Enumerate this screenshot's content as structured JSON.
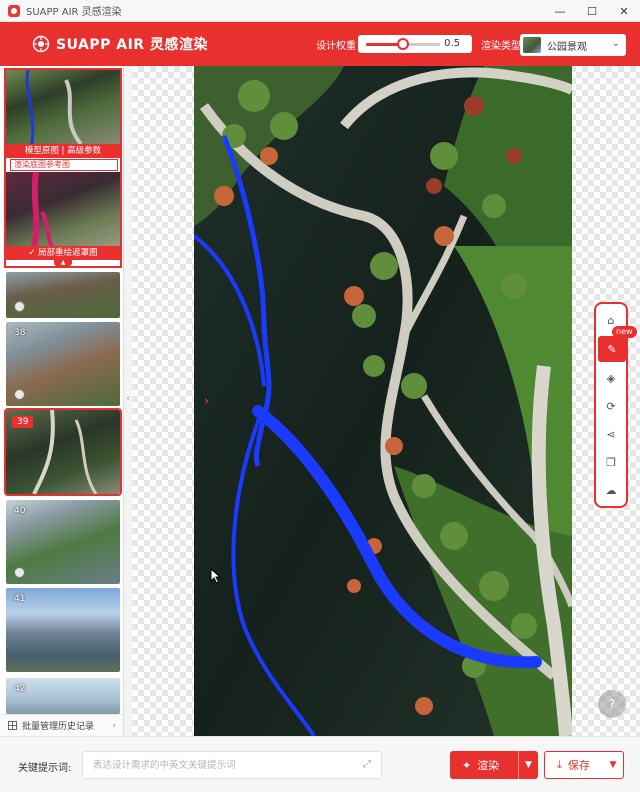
{
  "window": {
    "title": "SUAPP AIR 灵感渲染",
    "minimize": "—",
    "maximize": "☐",
    "close": "✕"
  },
  "header": {
    "brand": "SUAPP AIR 灵感渲染",
    "weight_label": "设计权重",
    "weight_value": "0.5",
    "weight_fraction": 0.5,
    "type_label": "渲染类型",
    "type_value": "公园景观",
    "accent": "#e8302f"
  },
  "left_panel": {
    "ref_tab": "模型原图 | 高级参数",
    "ref_sub": "渲染底图参考图",
    "ref_tab2": "局部重绘遮罩图",
    "thumbs": [
      {
        "num": ""
      },
      {
        "num": "38"
      },
      {
        "num": "39"
      },
      {
        "num": "40"
      },
      {
        "num": "41"
      },
      {
        "num": "42"
      }
    ],
    "batch_label": "批量管理历史记录"
  },
  "toolbar": {
    "tools": [
      "home-icon",
      "edit-icon",
      "layers-icon",
      "refresh-icon",
      "share-icon",
      "copy-icon",
      "cloud-upload-icon"
    ],
    "new_badge": "new"
  },
  "bottom": {
    "prompt_label": "关键提示词:",
    "prompt_placeholder": "表达设计需求的中英文关键提示词",
    "render_label": "渲染",
    "save_label": "保存"
  }
}
